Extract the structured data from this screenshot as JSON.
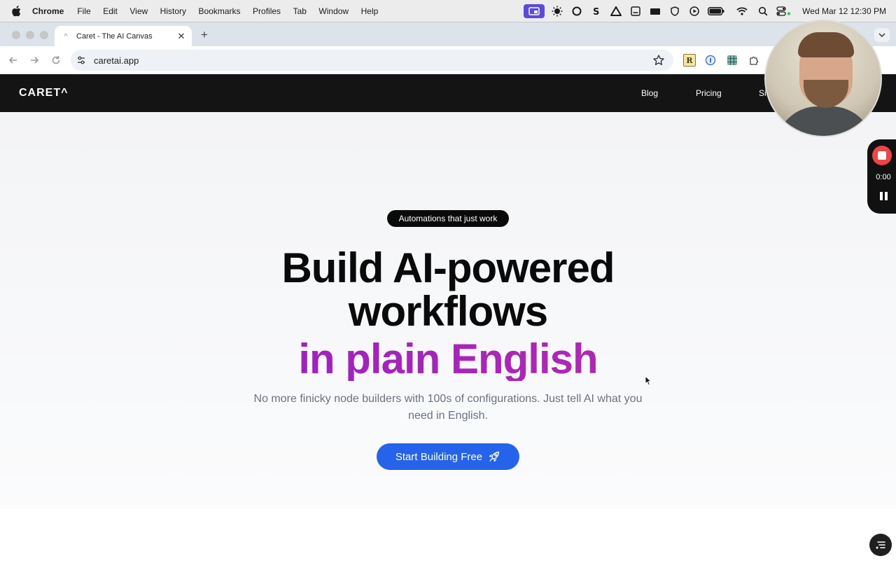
{
  "menubar": {
    "app_name": "Chrome",
    "items": [
      "File",
      "Edit",
      "View",
      "History",
      "Bookmarks",
      "Profiles",
      "Tab",
      "Window",
      "Help"
    ],
    "clock": "Wed Mar 12  12:30 PM"
  },
  "browser": {
    "tab_title": "Caret - The AI Canvas",
    "url": "caretai.app",
    "extension_r_label": "R"
  },
  "site": {
    "logo": "CARET^",
    "nav_links": [
      "Blog",
      "Pricing",
      "Si"
    ],
    "badge": "Automations that just work",
    "headline_line1": "Build AI-powered",
    "headline_line2": "workflows",
    "headline_accent": "in plain English",
    "subtext": "No more finicky node builders with 100s of configurations. Just tell AI what you need in English.",
    "cta_label": "Start Building Free",
    "colors": {
      "nav_background": "#141414",
      "accent_gradient_start": "#9b1fc4",
      "accent_gradient_end": "#b42ab0",
      "cta_background": "#2563eb"
    }
  },
  "recorder": {
    "time": "0:00"
  },
  "icons": [
    "apple-icon",
    "screen-share-icon",
    "brightness-icon",
    "circle-icon",
    "battery-icon",
    "wifi-icon",
    "search-icon",
    "control-center-icon",
    "site-info-icon",
    "bookmark-star-icon",
    "extensions-icon",
    "rocket-icon",
    "stop-icon",
    "pause-icon",
    "chat-menu-icon"
  ]
}
